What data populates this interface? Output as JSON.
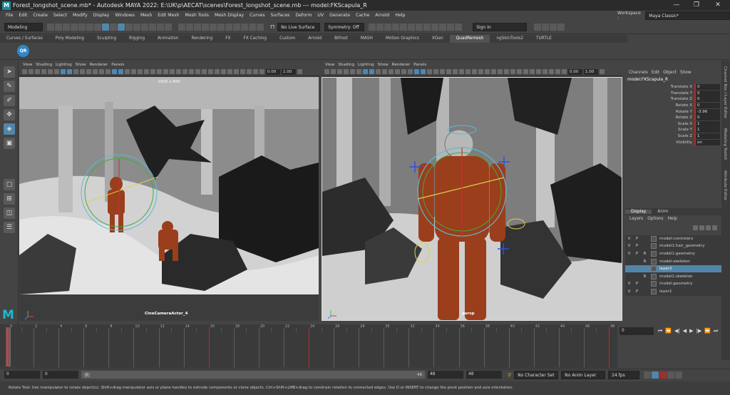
{
  "window": {
    "title": "Forest_longshot_scene.mb* - Autodesk MAYA 2022: E:\\UK\\p\\AECAT\\scenes\\Forest_longshot_scene.mb  ---  model:FKScapula_R",
    "logo_letter": "M",
    "minimize": "—",
    "restore": "❐",
    "close": "✕"
  },
  "menu": [
    "File",
    "Edit",
    "Create",
    "Select",
    "Modify",
    "Display",
    "Windows",
    "Mesh",
    "Edit Mesh",
    "Mesh Tools",
    "Mesh Display",
    "Curves",
    "Surfaces",
    "Deform",
    "UV",
    "Generate",
    "Cache",
    "Arnold",
    "Help"
  ],
  "workspace": {
    "label": "Workspace :",
    "value": "Maya Classic*"
  },
  "status": {
    "mode": "Modeling",
    "live_surface": "No Live Surface",
    "symmetry": "Symmetry: Off",
    "sign_in": "Sign In"
  },
  "shelf_tabs": [
    "Curves / Surfaces",
    "Poly Modeling",
    "Sculpting",
    "Rigging",
    "Animation",
    "Rendering",
    "FX",
    "FX Caching",
    "Custom",
    "Arnold",
    "Bifrost",
    "MASH",
    "Motion Graphics",
    "XGen",
    "QuadRemesh",
    "ngSkinTools2",
    "TURTLE"
  ],
  "shelf_active": "QuadRemesh",
  "shelf_icon_label": "QR",
  "panel_menu": [
    "View",
    "Shading",
    "Lighting",
    "Show",
    "Renderer",
    "Panels"
  ],
  "viewport_left": {
    "num1": "0.00",
    "num2": "1.00",
    "resolution": "1920 x 800",
    "camera": "CineCameraActor_4"
  },
  "viewport_right": {
    "num1": "0.00",
    "num2": "1.00",
    "camera": "persp"
  },
  "channel_box": {
    "menu": [
      "Channels",
      "Edit",
      "Object",
      "Show"
    ],
    "node": "model:FKScapula_R",
    "channels": [
      {
        "name": "Translate X",
        "value": "0"
      },
      {
        "name": "Translate Y",
        "value": "0"
      },
      {
        "name": "Translate Z",
        "value": "0"
      },
      {
        "name": "Rotate X",
        "value": "0"
      },
      {
        "name": "Rotate Y",
        "value": "-3.96"
      },
      {
        "name": "Rotate Z",
        "value": "0"
      },
      {
        "name": "Scale X",
        "value": "1"
      },
      {
        "name": "Scale Y",
        "value": "1"
      },
      {
        "name": "Scale Z",
        "value": "1"
      },
      {
        "name": "Visibility",
        "value": "on"
      }
    ]
  },
  "side_tabs": [
    "Channel Box / Layer Editor",
    "Modeling Toolkit",
    "Attribute Editor"
  ],
  "layers": {
    "tabs": [
      "Display",
      "Anim"
    ],
    "menu": [
      "Layers",
      "Options",
      "Help"
    ],
    "rows": [
      {
        "v": "V",
        "p": "P",
        "r": "",
        "name": "model:controlers",
        "selected": false
      },
      {
        "v": "V",
        "p": "P",
        "r": "",
        "name": "model1:hair_geometry",
        "selected": false
      },
      {
        "v": "V",
        "p": "P",
        "r": "R",
        "name": "model1:geometry",
        "selected": false
      },
      {
        "v": "",
        "p": "",
        "r": "R",
        "name": "model:skeleton",
        "selected": false
      },
      {
        "v": "",
        "p": "",
        "r": "",
        "name": "layer2",
        "selected": true
      },
      {
        "v": "",
        "p": "",
        "r": "R",
        "name": "model1:skeleton",
        "selected": false
      },
      {
        "v": "V",
        "p": "P",
        "r": "",
        "name": "model:geometry",
        "selected": false
      },
      {
        "v": "V",
        "p": "P",
        "r": "",
        "name": "layer1",
        "selected": false
      }
    ]
  },
  "timeline": {
    "ticks": [
      "0",
      "",
      "2",
      "",
      "4",
      "",
      "6",
      "",
      "8",
      "",
      "10",
      "",
      "12",
      "",
      "14",
      "",
      "16",
      "",
      "18",
      "",
      "20",
      "",
      "22",
      "",
      "24",
      "",
      "26",
      "",
      "28",
      "",
      "30",
      "",
      "32",
      "",
      "34",
      "",
      "36",
      "",
      "38",
      "",
      "40",
      "",
      "42",
      "",
      "44",
      "",
      "46",
      "",
      "48"
    ],
    "current_frame": "0"
  },
  "range": {
    "start": "0",
    "playback_start": "0",
    "range_start_box": "0",
    "range_end_box": "48",
    "playback_end": "48",
    "end": "48",
    "character_set": "No Character Set",
    "anim_layer": "No Anim Layer",
    "fps": "24 fps"
  },
  "help": "Rotate Tool: Use manipulator to rotate object(s). Shift+drag manipulator axis or plane handles to extrude components or clone objects. Ctrl+Shift+LMB+drag to constrain rotation to connected edges. Use D or INSERT to change the pivot position and axis orientation.",
  "colors": {
    "accent": "#5286a8",
    "keyframe_red": "#c0282d",
    "maya_teal": "#1fb6d0",
    "suit_orange": "#9a3e1c"
  }
}
